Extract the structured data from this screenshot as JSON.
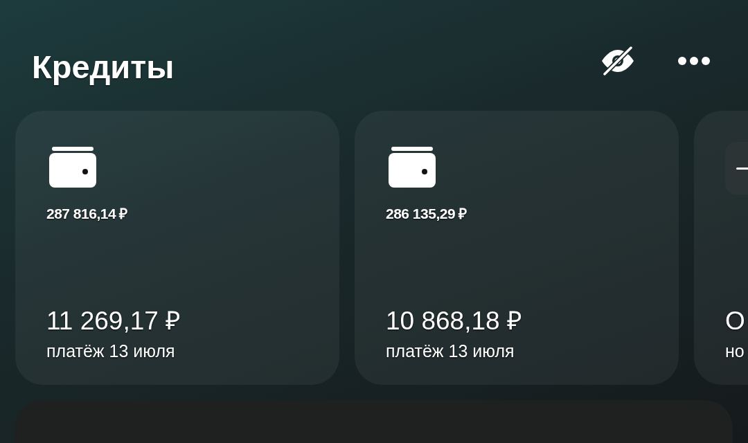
{
  "header": {
    "title": "Кредиты"
  },
  "loans": [
    {
      "kind": "wallet",
      "balance": "287 816,14 ₽",
      "payment": "11 269,17 ₽",
      "due": "платёж 13 июля"
    },
    {
      "kind": "wallet",
      "balance": "286 135,29 ₽",
      "payment": "10 868,18 ₽",
      "due": "платёж 13 июля"
    },
    {
      "kind": "tile",
      "payment": "О",
      "due": "но"
    }
  ]
}
